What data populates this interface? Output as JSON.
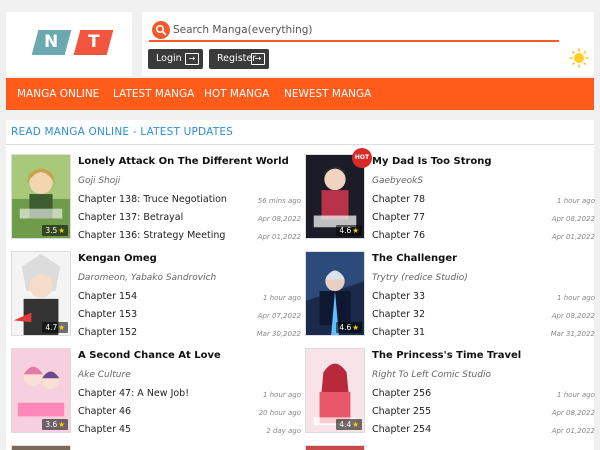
{
  "logo": {
    "letter1": "N",
    "letter2": "T"
  },
  "search": {
    "placeholder": "Search Manga(everything)"
  },
  "auth": {
    "login_label": "Login",
    "register_label": "Register"
  },
  "nav": {
    "items": [
      "MANGA ONLINE",
      "LATEST MANGA",
      "HOT MANGA",
      "NEWEST MANGA"
    ]
  },
  "panel": {
    "title": "READ MANGA ONLINE - LATEST UPDATES"
  },
  "colors": {
    "accent": "#ff5b1a",
    "title_blue": "#2f8fd6"
  },
  "manga": [
    {
      "title": "Lonely Attack On The Different World",
      "author": "Goji Shoji",
      "rating": "3.5",
      "hot": false,
      "chapters": [
        {
          "name": "Chapter 138: Truce Negotiation",
          "time": "56 mins ago"
        },
        {
          "name": "Chapter 137: Betrayal",
          "time": "Apr 08,2022"
        },
        {
          "name": "Chapter 136: Strategy Meeting",
          "time": "Apr 01,2022"
        }
      ]
    },
    {
      "title": "My Dad Is Too Strong",
      "author": "GaebyeokS",
      "rating": "4.6",
      "hot": true,
      "hot_label": "HOT",
      "chapters": [
        {
          "name": "Chapter 78",
          "time": "1 hour ago"
        },
        {
          "name": "Chapter 77",
          "time": "Apr 08,2022"
        },
        {
          "name": "Chapter 76",
          "time": "Apr 01,2022"
        }
      ]
    },
    {
      "title": "Kengan Omeg",
      "author": "Daromeon, Yabako Sandrovich",
      "rating": "4.7",
      "hot": false,
      "chapters": [
        {
          "name": "Chapter 154",
          "time": "1 hour ago"
        },
        {
          "name": "Chapter 153",
          "time": "Apr 07,2022"
        },
        {
          "name": "Chapter 152",
          "time": "Mar 30,2022"
        }
      ]
    },
    {
      "title": "The Challenger",
      "author": "Trytry (redice Studio)",
      "rating": "4.6",
      "hot": false,
      "chapters": [
        {
          "name": "Chapter 33",
          "time": "1 hour ago"
        },
        {
          "name": "Chapter 32",
          "time": "Apr 08,2022"
        },
        {
          "name": "Chapter 31",
          "time": "Mar 31,2022"
        }
      ]
    },
    {
      "title": "A Second Chance At Love",
      "author": "Ake Culture",
      "rating": "3.6",
      "hot": false,
      "chapters": [
        {
          "name": "Chapter 47: A New Job!",
          "time": "1 hour ago"
        },
        {
          "name": "Chapter 46",
          "time": "20 hour ago"
        },
        {
          "name": "Chapter 45",
          "time": "2 day ago"
        }
      ]
    },
    {
      "title": "The Princess's Time Travel",
      "author": "Right To Left Comic Studio",
      "rating": "4.4",
      "hot": false,
      "chapters": [
        {
          "name": "Chapter 256",
          "time": "1 hour ago"
        },
        {
          "name": "Chapter 255",
          "time": "Apr 08,2022"
        },
        {
          "name": "Chapter 254",
          "time": "Apr 01,2022"
        }
      ]
    }
  ]
}
